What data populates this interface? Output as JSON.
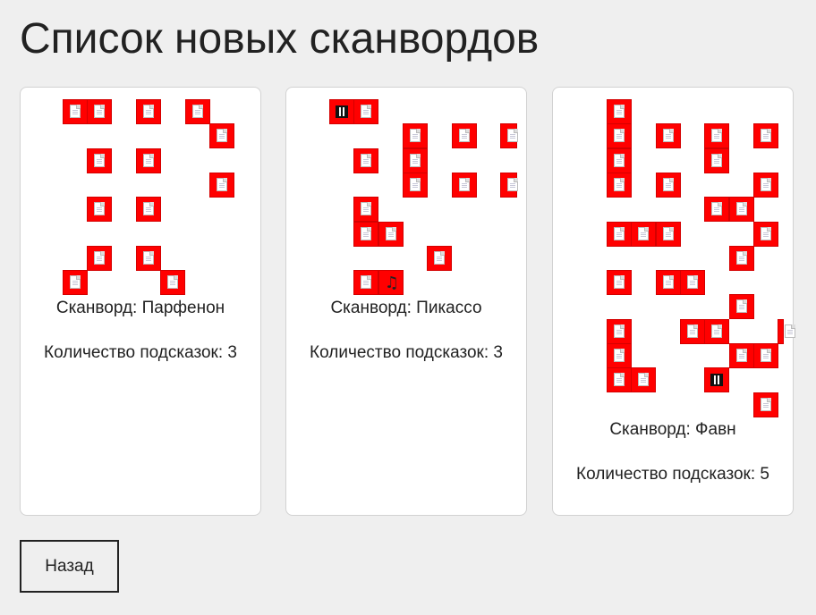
{
  "page": {
    "title": "Список новых сканвордов",
    "back_label": "Назад"
  },
  "colors": {
    "background": "#efefef",
    "cell": "#ff0000",
    "card": "#ffffff"
  },
  "crosswords": [
    {
      "name_label": "Сканворд: Парфенон",
      "hints_label": "Количество подсказок: 3",
      "cells": [
        {
          "col": 0,
          "row": 0,
          "icon": "doc-icon"
        },
        {
          "col": 1,
          "row": 0,
          "icon": "doc-icon"
        },
        {
          "col": 3,
          "row": 0,
          "icon": "doc-icon"
        },
        {
          "col": 5,
          "row": 0,
          "icon": "doc-icon"
        },
        {
          "col": 6,
          "row": 1,
          "icon": "doc-icon"
        },
        {
          "col": 1,
          "row": 2,
          "icon": "doc-icon"
        },
        {
          "col": 3,
          "row": 2,
          "icon": "doc-icon"
        },
        {
          "col": 6,
          "row": 3,
          "icon": "doc-icon"
        },
        {
          "col": 1,
          "row": 4,
          "icon": "doc-icon"
        },
        {
          "col": 3,
          "row": 4,
          "icon": "doc-icon"
        },
        {
          "col": 1,
          "row": 6,
          "icon": "doc-icon"
        },
        {
          "col": 3,
          "row": 6,
          "icon": "doc-icon"
        },
        {
          "col": 0,
          "row": 7,
          "icon": "doc-icon"
        },
        {
          "col": 4,
          "row": 7,
          "icon": "doc-icon"
        }
      ]
    },
    {
      "name_label": "Сканворд: Пикассо",
      "hints_label": "Количество подсказок: 3",
      "cells": [
        {
          "col": 0,
          "row": 0,
          "icon": "qr-icon"
        },
        {
          "col": 1,
          "row": 0,
          "icon": "doc-icon"
        },
        {
          "col": 3,
          "row": 1,
          "icon": "doc-icon"
        },
        {
          "col": 5,
          "row": 1,
          "icon": "doc-icon"
        },
        {
          "col": 7,
          "row": 1,
          "icon": "doc-icon"
        },
        {
          "col": 1,
          "row": 2,
          "icon": "doc-icon"
        },
        {
          "col": 3,
          "row": 2,
          "icon": "doc-icon"
        },
        {
          "col": 3,
          "row": 3,
          "icon": "doc-icon"
        },
        {
          "col": 5,
          "row": 3,
          "icon": "doc-icon"
        },
        {
          "col": 7,
          "row": 3,
          "icon": "doc-icon"
        },
        {
          "col": 1,
          "row": 4,
          "icon": "doc-icon"
        },
        {
          "col": 1,
          "row": 5,
          "icon": "doc-icon"
        },
        {
          "col": 2,
          "row": 5,
          "icon": "doc-icon"
        },
        {
          "col": 4,
          "row": 6,
          "icon": "doc-icon"
        },
        {
          "col": 1,
          "row": 7,
          "icon": "doc-icon"
        },
        {
          "col": 2,
          "row": 7,
          "icon": "music-note-icon"
        }
      ]
    },
    {
      "name_label": "Сканворд: Фавн",
      "hints_label": "Количество подсказок: 5",
      "cells": [
        {
          "col": 0,
          "row": 0,
          "icon": "doc-icon"
        },
        {
          "col": 0,
          "row": 1,
          "icon": "doc-icon"
        },
        {
          "col": 2,
          "row": 1,
          "icon": "doc-icon"
        },
        {
          "col": 4,
          "row": 1,
          "icon": "doc-icon"
        },
        {
          "col": 6,
          "row": 1,
          "icon": "doc-icon"
        },
        {
          "col": 0,
          "row": 2,
          "icon": "doc-icon"
        },
        {
          "col": 4,
          "row": 2,
          "icon": "doc-icon"
        },
        {
          "col": 0,
          "row": 3,
          "icon": "doc-icon"
        },
        {
          "col": 2,
          "row": 3,
          "icon": "doc-icon"
        },
        {
          "col": 6,
          "row": 3,
          "icon": "doc-icon"
        },
        {
          "col": 4,
          "row": 4,
          "icon": "doc-icon"
        },
        {
          "col": 5,
          "row": 4,
          "icon": "doc-icon"
        },
        {
          "col": 0,
          "row": 5,
          "icon": "doc-icon"
        },
        {
          "col": 1,
          "row": 5,
          "icon": "doc-icon"
        },
        {
          "col": 2,
          "row": 5,
          "icon": "doc-icon"
        },
        {
          "col": 6,
          "row": 5,
          "icon": "doc-icon"
        },
        {
          "col": 5,
          "row": 6,
          "icon": "doc-icon"
        },
        {
          "col": 0,
          "row": 7,
          "icon": "doc-icon"
        },
        {
          "col": 2,
          "row": 7,
          "icon": "doc-icon"
        },
        {
          "col": 3,
          "row": 7,
          "icon": "doc-icon"
        },
        {
          "col": 5,
          "row": 8,
          "icon": "doc-icon"
        },
        {
          "col": 0,
          "row": 9,
          "icon": "doc-icon"
        },
        {
          "col": 3,
          "row": 9,
          "icon": "doc-icon"
        },
        {
          "col": 4,
          "row": 9,
          "icon": "doc-icon"
        },
        {
          "col": 7,
          "row": 9,
          "icon": "doc-icon"
        },
        {
          "col": 0,
          "row": 10,
          "icon": "doc-icon"
        },
        {
          "col": 5,
          "row": 10,
          "icon": "doc-icon"
        },
        {
          "col": 6,
          "row": 10,
          "icon": "doc-icon"
        },
        {
          "col": 0,
          "row": 11,
          "icon": "doc-icon"
        },
        {
          "col": 1,
          "row": 11,
          "icon": "doc-icon"
        },
        {
          "col": 4,
          "row": 11,
          "icon": "qr-icon"
        },
        {
          "col": 6,
          "row": 12,
          "icon": "doc-icon"
        }
      ]
    }
  ]
}
